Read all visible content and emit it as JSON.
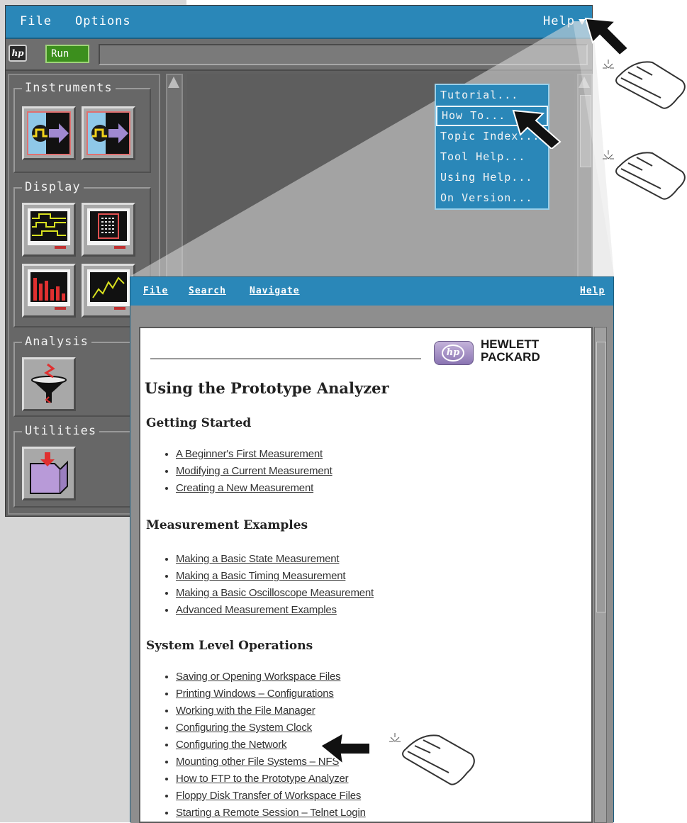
{
  "main_window": {
    "menu": {
      "file": "File",
      "options": "Options",
      "help": "Help"
    },
    "toolbar": {
      "hp_logo": "hp",
      "run": "Run"
    },
    "panels": {
      "instruments": "Instruments",
      "display": "Display",
      "analysis": "Analysis",
      "utilities": "Utilities"
    }
  },
  "help_menu": {
    "items": [
      "Tutorial...",
      "How To...",
      "Topic Index...",
      "Tool Help...",
      "Using Help...",
      "On Version..."
    ],
    "selected_index": 1
  },
  "help_window": {
    "menu": {
      "file": "File",
      "search": "Search",
      "navigate": "Navigate",
      "help": "Help"
    },
    "logo": {
      "mark": "hp",
      "line1": "HEWLETT",
      "line2": "PACKARD"
    },
    "title": "Using the Prototype Analyzer",
    "sections": [
      {
        "heading": "Getting Started",
        "links": [
          "A Beginner's First Measurement",
          "Modifying a Current Measurement",
          "Creating a New Measurement"
        ]
      },
      {
        "heading": "Measurement Examples",
        "links": [
          "Making a Basic State Measurement",
          "Making a Basic Timing Measurement",
          "Making a Basic Oscilloscope Measurement",
          "Advanced Measurement Examples"
        ]
      },
      {
        "heading": "System Level Operations",
        "links": [
          "Saving or Opening Workspace Files",
          "Printing Windows – Configurations",
          "Working with the File Manager",
          "Configuring the System Clock",
          "Configuring the Network",
          "Mounting other File Systems – NFS",
          "How to FTP to the Prototype Analyzer",
          "Floppy Disk Transfer of Workspace Files",
          "Starting a Remote Session – Telnet Login"
        ]
      }
    ]
  },
  "colors": {
    "menubar_blue": "#2a87b8",
    "panel_gray": "#676767",
    "run_green": "#3c8f1d",
    "help_bg": "#ffffff",
    "beam": "#dcdcdc"
  }
}
